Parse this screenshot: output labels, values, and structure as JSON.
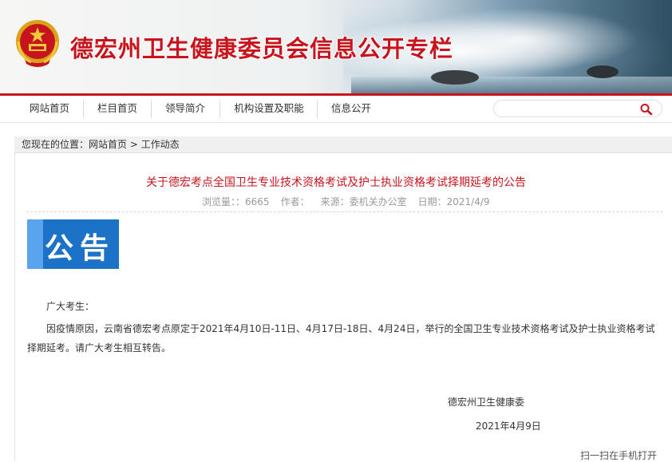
{
  "header": {
    "site_title": "德宏州卫生健康委员会信息公开专栏",
    "emblem_icon": "national-emblem-icon",
    "brand_color": "#c8151d"
  },
  "nav": {
    "items": [
      {
        "label": "网站首页"
      },
      {
        "label": "栏目首页"
      },
      {
        "label": "领导简介"
      },
      {
        "label": "机构设置及职能"
      },
      {
        "label": "信息公开"
      }
    ],
    "search": {
      "value": "",
      "placeholder": ""
    }
  },
  "breadcrumb": {
    "prefix": "您现在的位置：",
    "home": "网站首页",
    "separator": " > ",
    "current": "工作动态"
  },
  "article": {
    "title": "关于德宏考点全国卫生专业技术资格考试及护士执业资格考试择期延考的公告",
    "views_label": "浏览量：：",
    "views": "6665",
    "author_label": "作者：",
    "source_label": "来源：",
    "source": "委机关办公室",
    "date_label": "日期：",
    "date": "2021/4/9",
    "notice_image_text": "公告",
    "salutation": "广大考生：",
    "body": "因疫情原因，云南省德宏考点原定于2021年4月10日-11日、4月17日-18日、4月24日，举行的全国卫生专业技术资格考试及护士执业资格考试择期延考。请广大考生相互转告。",
    "signature": "德宏州卫生健康委",
    "sign_date": "2021年4月9日",
    "qr_hint": "扫一扫在手机打开"
  }
}
